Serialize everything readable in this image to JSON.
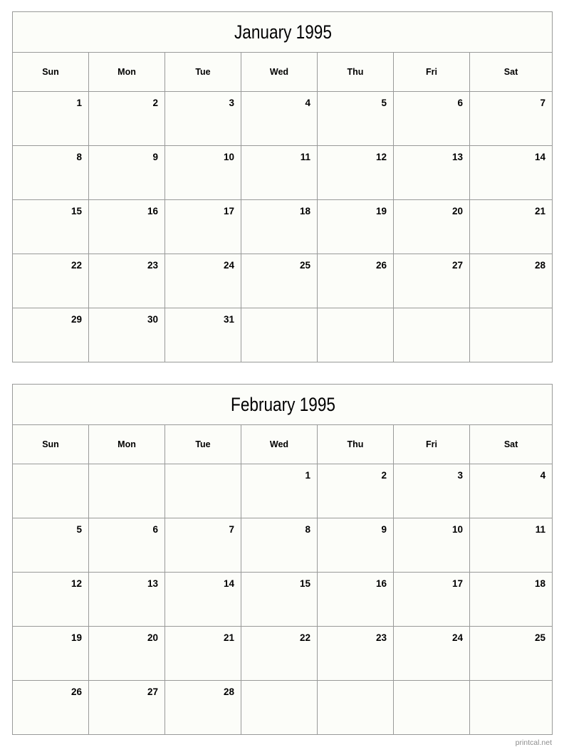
{
  "page": {
    "footer_watermark": "printcal.net"
  },
  "calendars": [
    {
      "title": "January 1995",
      "weekdays": [
        "Sun",
        "Mon",
        "Tue",
        "Wed",
        "Thu",
        "Fri",
        "Sat"
      ],
      "weeks": [
        [
          "1",
          "2",
          "3",
          "4",
          "5",
          "6",
          "7"
        ],
        [
          "8",
          "9",
          "10",
          "11",
          "12",
          "13",
          "14"
        ],
        [
          "15",
          "16",
          "17",
          "18",
          "19",
          "20",
          "21"
        ],
        [
          "22",
          "23",
          "24",
          "25",
          "26",
          "27",
          "28"
        ],
        [
          "29",
          "30",
          "31",
          "",
          "",
          "",
          ""
        ]
      ]
    },
    {
      "title": "February 1995",
      "weekdays": [
        "Sun",
        "Mon",
        "Tue",
        "Wed",
        "Thu",
        "Fri",
        "Sat"
      ],
      "weeks": [
        [
          "",
          "",
          "",
          "1",
          "2",
          "3",
          "4"
        ],
        [
          "5",
          "6",
          "7",
          "8",
          "9",
          "10",
          "11"
        ],
        [
          "12",
          "13",
          "14",
          "15",
          "16",
          "17",
          "18"
        ],
        [
          "19",
          "20",
          "21",
          "22",
          "23",
          "24",
          "25"
        ],
        [
          "26",
          "27",
          "28",
          "",
          "",
          "",
          ""
        ]
      ]
    }
  ]
}
